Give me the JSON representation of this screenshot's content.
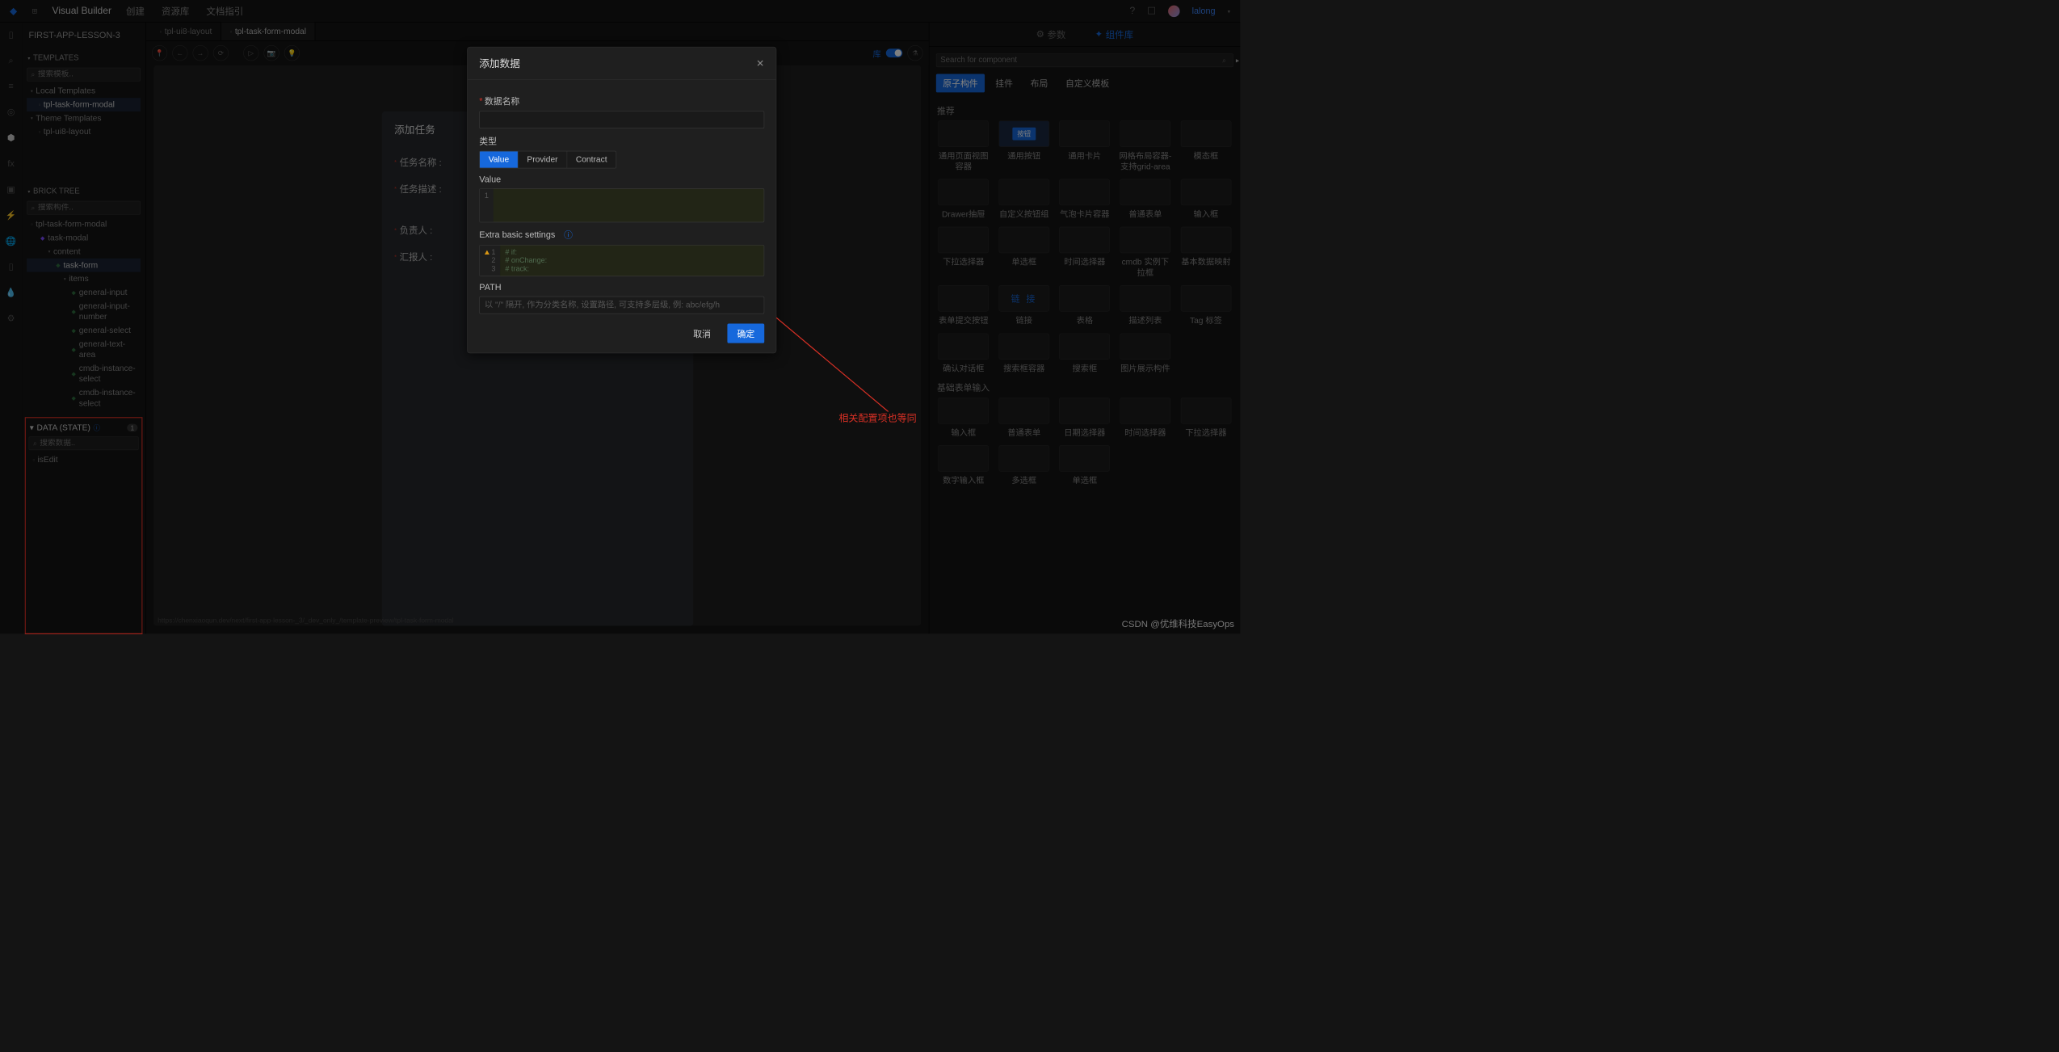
{
  "topbar": {
    "brand": "Visual Builder",
    "menu": [
      "创建",
      "资源库",
      "文档指引"
    ],
    "user": "lalong"
  },
  "project": "FIRST-APP-LESSON-3",
  "panels": {
    "templates": {
      "title": "TEMPLATES",
      "search_ph": "搜索模板..",
      "groups": [
        {
          "name": "Local Templates",
          "items": [
            "tpl-task-form-modal"
          ]
        },
        {
          "name": "Theme Templates",
          "items": [
            "tpl-ui8-layout"
          ]
        }
      ]
    },
    "bricktree": {
      "title": "BRICK TREE",
      "search_ph": "搜索构件..",
      "root": "tpl-task-form-modal",
      "items": [
        {
          "name": "task-modal",
          "indent": 28,
          "icon": "purple"
        },
        {
          "name": "content",
          "indent": 44,
          "caret": true
        },
        {
          "name": "task-form",
          "indent": 60,
          "icon": "green",
          "sel": true
        },
        {
          "name": "items",
          "indent": 76,
          "caret": true
        },
        {
          "name": "general-input",
          "indent": 92,
          "icon": "green"
        },
        {
          "name": "general-input-number",
          "indent": 92,
          "icon": "green"
        },
        {
          "name": "general-select",
          "indent": 92,
          "icon": "green"
        },
        {
          "name": "general-text-area",
          "indent": 92,
          "icon": "green"
        },
        {
          "name": "cmdb-instance-select",
          "indent": 92,
          "icon": "green"
        },
        {
          "name": "cmdb-instance-select",
          "indent": 92,
          "icon": "green"
        }
      ]
    },
    "data": {
      "title": "DATA (STATE)",
      "count": "1",
      "search_ph": "搜索数据..",
      "items": [
        "isEdit"
      ]
    }
  },
  "tabs": [
    {
      "label": "tpl-ui8-layout",
      "active": false
    },
    {
      "label": "tpl-task-form-modal",
      "active": true
    }
  ],
  "form_card": {
    "title": "添加任务",
    "rows": [
      "任务名称 :",
      "任务描述 :",
      "负责人 :",
      "汇报人 :"
    ]
  },
  "status_url": "https://chenxiaoqun.dev/next/first-app-lesson-_3/_dev_only_/template-preview/tpl-task-form-modal",
  "rightpanel": {
    "tabs": [
      "参数",
      "组件库"
    ],
    "search_ph": "Search for component",
    "chips": [
      "原子构件",
      "挂件",
      "布局",
      "自定义模板"
    ],
    "section1": "推荐",
    "grid1": [
      "通用页面视图容器",
      "通用按钮",
      "通用卡片",
      "网格布局容器-支持grid-area",
      "模态框",
      "Drawer抽屉",
      "自定义按钮组",
      "气泡卡片容器",
      "普通表单",
      "输入框",
      "下拉选择器",
      "单选框",
      "时间选择器",
      "cmdb 实例下拉框",
      "基本数据映射",
      "表单提交按钮",
      "链接",
      "表格",
      "描述列表",
      "Tag 标签",
      "确认对话框",
      "搜索框容器",
      "搜索框",
      "图片展示构件"
    ],
    "section2": "基础表单输入",
    "grid2": [
      "输入框",
      "普通表单",
      "日期选择器",
      "时间选择器",
      "下拉选择器",
      "数字输入框",
      "多选框",
      "单选框"
    ],
    "thumb_btn": "按钮",
    "thumb_link": "链 接"
  },
  "modal": {
    "title": "添加数据",
    "name_label": "数据名称",
    "type_label": "类型",
    "type_opts": [
      "Value",
      "Provider",
      "Contract"
    ],
    "value_label": "Value",
    "value_gutter": "1",
    "extra_label": "Extra basic settings",
    "extra_gutter": [
      "1",
      "2",
      "3"
    ],
    "extra_code": "# if:\n# onChange:\n# track:",
    "path_label": "PATH",
    "path_ph": "以 \"/\" 隔开, 作为分类名称, 设置路径, 可支持多层级, 例: abc/efg/h",
    "cancel": "取消",
    "ok": "确定"
  },
  "annotation": "相关配置项也等同",
  "watermark": "CSDN @优维科技EasyOps"
}
